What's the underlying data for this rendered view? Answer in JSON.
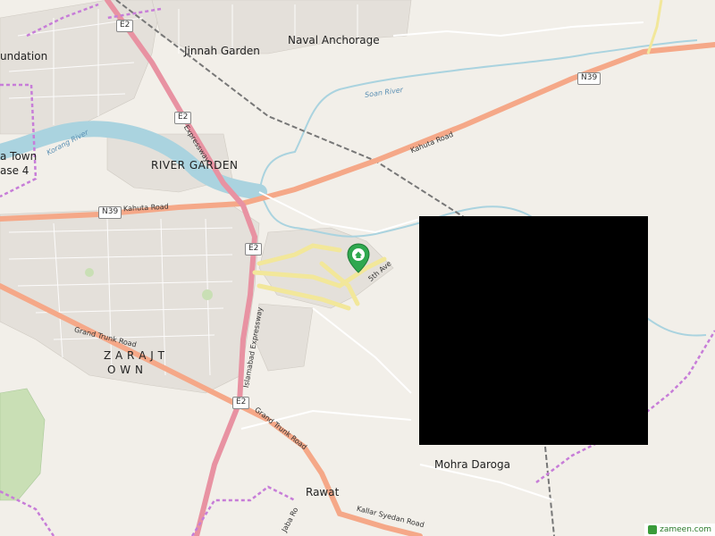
{
  "map": {
    "places": {
      "foundation": "undation",
      "jinnah_garden": "Jinnah Garden",
      "naval_anchorage": "Naval Anchorage",
      "river_garden": "RIVER GARDEN",
      "town_line1": "a Town",
      "town_line2": "ase 4",
      "zarajt_line1": "Z A R A J  T",
      "zarajt_line2": "O W N",
      "mohra_daroga": "Mohra Daroga",
      "rawat": "Rawat"
    },
    "roads": {
      "e2_a": "E2",
      "e2_b": "E2",
      "e2_c": "E2",
      "e2_d": "E2",
      "n39_a": "N39",
      "n39_b": "N39",
      "kahuta_road_1": "Kahuta Road",
      "kahuta_road_2": "Kahuta Road",
      "expressway": "Expressway",
      "islamabad_expressway": "Islamabad Expressway",
      "grand_trunk_road_1": "Grand Trunk Road",
      "grand_trunk_road_2": "Grand Trunk Road",
      "fifth_ave": "5th Ave",
      "kallar_syedan_road": "Kallar Syedan Road",
      "jaba_road": "Jaba Ro"
    },
    "rivers": {
      "soan_river": "Soan River",
      "korang_river": "Korang River"
    },
    "marker_icon": "location-pin-icon",
    "attribution": "zameen.com",
    "colors": {
      "land": "#f2efe9",
      "water": "#aad3df",
      "primary_road": "#e892a2",
      "trunk_road": "#f5a888",
      "boundary": "#c77dd8",
      "marker": "#2fa84f",
      "redaction": "#000000"
    }
  }
}
